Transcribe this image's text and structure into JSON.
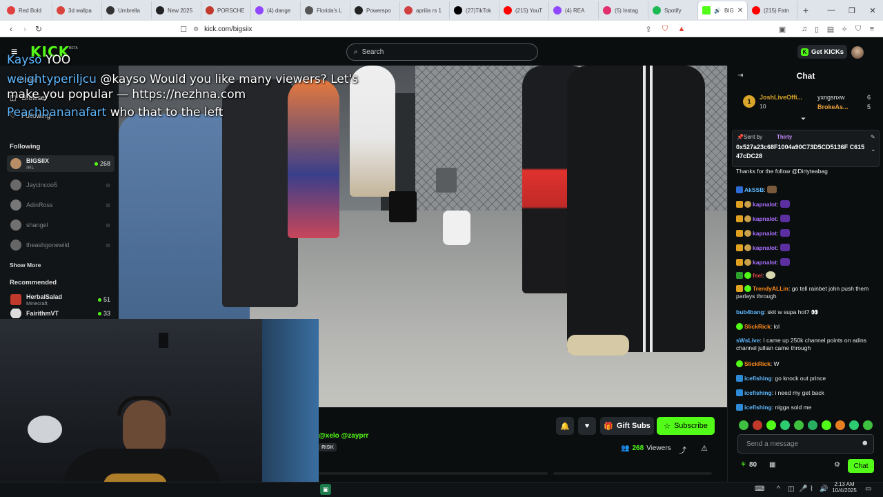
{
  "browser": {
    "tabs": [
      {
        "label": "Red Bold",
        "color": "#e04040"
      },
      {
        "label": "3d wallpa",
        "color": "#d8443c"
      },
      {
        "label": "Umbrella",
        "color": "#333333"
      },
      {
        "label": "New 2025",
        "color": "#222222"
      },
      {
        "label": "PORSCHE",
        "color": "#c0392b"
      },
      {
        "label": "(4) dange",
        "color": "#9146ff"
      },
      {
        "label": "Florida's L",
        "color": "#555555"
      },
      {
        "label": "Powerspo",
        "color": "#222222"
      },
      {
        "label": "aprilia rs 1",
        "color": "#d04040"
      },
      {
        "label": "(27)TikTok",
        "color": "#000000"
      },
      {
        "label": "(215) YouT",
        "color": "#ff0000"
      },
      {
        "label": "(4) REA",
        "color": "#9146ff"
      },
      {
        "label": "(5) Instag",
        "color": "#e1306c"
      },
      {
        "label": "Spotify",
        "color": "#1db954"
      },
      {
        "label": "BIG",
        "color": "#53fc18"
      },
      {
        "label": "(215) Fatn",
        "color": "#ff0000"
      }
    ],
    "url": "kick.com/bigsiix"
  },
  "kick": {
    "logo": "KICK",
    "beta": "BETA",
    "search_placeholder": "Search",
    "get_kicks": "Get KICKs"
  },
  "sidebar": {
    "nav": [
      "Home",
      "Browse",
      "Following"
    ],
    "following_header": "Following",
    "following": [
      {
        "name": "BIGSIIX",
        "category": "IRL",
        "viewers": "268",
        "live": true,
        "avatar": "#b98d66"
      },
      {
        "name": "Jaycincoo5",
        "live": false,
        "avatar": "#6a6a6a"
      },
      {
        "name": "AdinRoss",
        "live": false,
        "avatar": "#777777"
      },
      {
        "name": "shangel",
        "live": false,
        "avatar": "#707070"
      },
      {
        "name": "theashgonewild",
        "live": false,
        "avatar": "#666666"
      }
    ],
    "show_more": "Show More",
    "recommended_header": "Recommended",
    "recommended": [
      {
        "name": "HerbalSalad",
        "category": "Minecraft",
        "viewers": "51",
        "avatar": "#c0392b"
      },
      {
        "name": "FairithmVT",
        "viewers": "33",
        "avatar": "#ddd"
      }
    ]
  },
  "overlay_chat": [
    {
      "user": "Kayso",
      "text": "YOO",
      "user_color": "#5eb8ff"
    },
    {
      "user": "weightyperiljcu",
      "text": "@kayso Would you like many viewers? Let's",
      "user_color": "#5eb8ff"
    },
    {
      "user": "",
      "text": "make you popular — https://nezhna.com",
      "user_color": "#ffffff"
    },
    {
      "user": "Peachbananafart",
      "text": "who that to the left",
      "user_color": "#5eb8ff"
    }
  ],
  "stream": {
    "title_tags": "@xelo @zayprr",
    "tag": "RISK",
    "viewers": "268",
    "viewers_label": "Viewers",
    "gift_subs": "Gift Subs",
    "subscribe": "Subscribe"
  },
  "chat": {
    "title": "Chat",
    "leaderboard": [
      {
        "rank": "1",
        "name": "JoshLiveOffi...",
        "value": "10"
      },
      {
        "name": "yxngsnxw",
        "value": "6"
      },
      {
        "name": "BrokeAs...",
        "value": "5"
      }
    ],
    "pinned": {
      "sent_by_label": "Sent by",
      "sender": "Thirty",
      "text": "0x527a23c68F1004a90C73D5CD5136F C61547cDC28"
    },
    "messages": [
      {
        "user": "",
        "text": "Thanks for the follow @Dirtyteabag",
        "color": "#e84444"
      },
      {
        "user": "AkSSB",
        "text": "",
        "color": "#5eb8ff"
      },
      {
        "user": "kapnalot",
        "text": "",
        "color": "#a970ff"
      },
      {
        "user": "kapnalot",
        "text": "",
        "color": "#a970ff"
      },
      {
        "user": "kapnalot",
        "text": "",
        "color": "#a970ff"
      },
      {
        "user": "kapnalot",
        "text": "",
        "color": "#a970ff"
      },
      {
        "user": "kapnalot",
        "text": "",
        "color": "#a970ff"
      },
      {
        "user": "feel",
        "text": "",
        "color": "#e84444"
      },
      {
        "user": "TrendyALLin",
        "text": "go tell rainbet john push them parlays through",
        "color": "#ff8c1a"
      },
      {
        "user": "bub4bang",
        "text": "skit w supa hot? 👀",
        "color": "#5eb8ff"
      },
      {
        "user": "SlickRick",
        "text": "lol",
        "color": "#ff8c1a"
      },
      {
        "user": "sWsLive",
        "text": "I came up 250k channel points on adins channel jullian came through",
        "color": "#5eb8ff"
      },
      {
        "user": "SlickRick",
        "text": "W",
        "color": "#ff8c1a"
      },
      {
        "user": "icefishing",
        "text": "go knock out prince",
        "color": "#5eb8ff"
      },
      {
        "user": "icefishing",
        "text": "i need my get back",
        "color": "#5eb8ff"
      },
      {
        "user": "icefishing",
        "text": "nigga sold me",
        "color": "#5eb8ff"
      }
    ],
    "input_placeholder": "Send a message",
    "points": "80",
    "send_label": "Chat"
  },
  "taskbar": {
    "time": "2:13 AM",
    "date": "10/4/2025"
  },
  "colors": {
    "kick_green": "#53fc18",
    "bg": "#0b0e0f"
  }
}
